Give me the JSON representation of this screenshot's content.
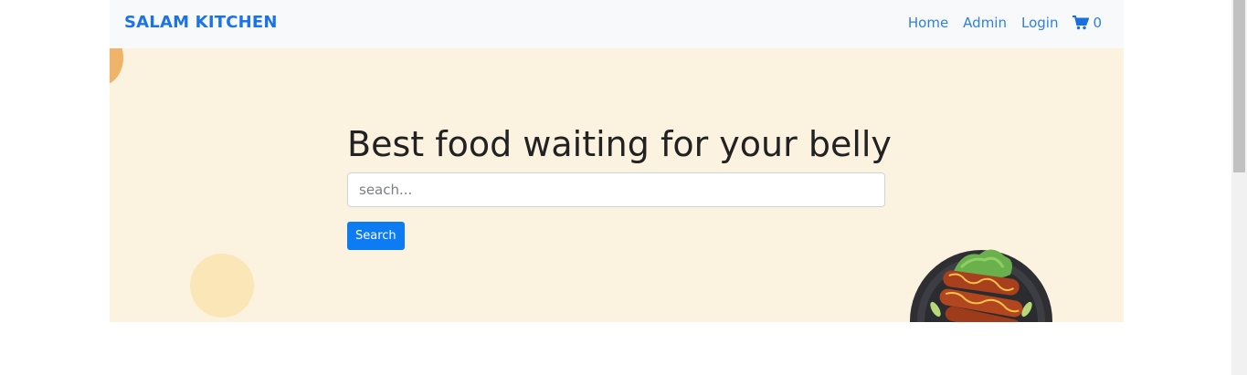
{
  "navbar": {
    "brand": "SALAM KITCHEN",
    "links": [
      "Home",
      "Admin",
      "Login"
    ],
    "cart_count": "0",
    "cart_icon": "shopping-cart-icon"
  },
  "hero": {
    "title": "Best food waiting for your belly",
    "search_placeholder": "seach...",
    "search_button": "Search",
    "colors": {
      "background": "#fcf2e0",
      "accent": "#0d7cf2",
      "brand": "#1a73e8"
    }
  }
}
